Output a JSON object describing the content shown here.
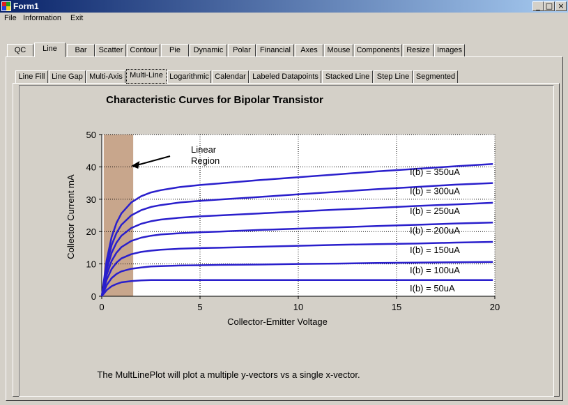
{
  "window": {
    "title": "Form1"
  },
  "menu": [
    "File",
    "Information",
    "Exit"
  ],
  "main_tabs": [
    "QC",
    "Line",
    "Bar",
    "Scatter",
    "Contour",
    "Pie",
    "Dynamic",
    "Polar",
    "Financial",
    "Axes",
    "Mouse",
    "Components",
    "Resize",
    "Images"
  ],
  "main_tab_active": "Line",
  "sub_tabs": [
    "Line Fill",
    "Line Gap",
    "Multi-Axis",
    "Multi-Line",
    "Logarithmic",
    "Calendar",
    "Labeled Datapoints",
    "Stacked Line",
    "Step Line",
    "Segmented"
  ],
  "sub_tab_active": "Multi-Line",
  "caption": "The MultLinePlot will plot a multiple y-vectors vs a single x-vector.",
  "colors": {
    "line": "#2a1fcc",
    "region_fill": "#c8a68c",
    "grid": "#000000"
  },
  "chart_data": {
    "type": "line",
    "title": "Characteristic Curves for Bipolar Transistor",
    "xlabel": "Collector-Emitter Voltage",
    "ylabel": "Collector Current mA",
    "xlim": [
      0,
      20
    ],
    "ylim": [
      0,
      50
    ],
    "x_ticks": [
      "0",
      "5",
      "10",
      "15",
      "20"
    ],
    "y_ticks": [
      "0",
      "10",
      "20",
      "30",
      "40",
      "50"
    ],
    "grid": true,
    "x": [
      0,
      0.25,
      0.5,
      0.75,
      1,
      1.5,
      2,
      2.5,
      3,
      4,
      5,
      6,
      8,
      10,
      12,
      14,
      16,
      18,
      19.9
    ],
    "series": [
      {
        "name": "I(b) = 50uA",
        "values": [
          0,
          1.9,
          3.1,
          3.8,
          4.3,
          4.7,
          4.9,
          5.0,
          5.0,
          5.0,
          5.0,
          5.0,
          5.0,
          5.0,
          5.0,
          5.0,
          5.0,
          5.0,
          5.0
        ]
      },
      {
        "name": "I(b) = 100uA",
        "values": [
          0,
          3.4,
          5.6,
          6.9,
          7.7,
          8.5,
          8.9,
          9.2,
          9.3,
          9.5,
          9.6,
          9.7,
          9.8,
          10.0,
          10.1,
          10.3,
          10.4,
          10.5,
          10.6
        ]
      },
      {
        "name": "I(b) = 150uA",
        "values": [
          0,
          5.1,
          8.4,
          10.4,
          11.7,
          13.0,
          13.7,
          14.1,
          14.4,
          14.7,
          14.9,
          15.0,
          15.3,
          15.6,
          15.9,
          16.1,
          16.3,
          16.6,
          16.8
        ]
      },
      {
        "name": "I(b) = 200uA",
        "values": [
          0,
          6.6,
          10.9,
          13.5,
          15.2,
          17.1,
          18.1,
          18.7,
          19.1,
          19.5,
          19.8,
          20.0,
          20.5,
          20.9,
          21.3,
          21.7,
          22.1,
          22.5,
          22.8
        ]
      },
      {
        "name": "I(b) = 250uA",
        "values": [
          0,
          8.1,
          13.4,
          16.6,
          18.7,
          21.1,
          22.4,
          23.2,
          23.7,
          24.3,
          24.7,
          25.0,
          25.6,
          26.2,
          26.8,
          27.3,
          27.9,
          28.4,
          28.9
        ]
      },
      {
        "name": "I(b) = 300uA",
        "values": [
          0,
          9.6,
          15.8,
          19.6,
          22.1,
          25.0,
          26.6,
          27.6,
          28.2,
          29.0,
          29.5,
          29.9,
          30.7,
          31.5,
          32.3,
          33.1,
          33.8,
          34.5,
          35.0
        ]
      },
      {
        "name": "I(b) = 350uA",
        "values": [
          0,
          11.1,
          18.3,
          22.7,
          25.6,
          29.0,
          30.9,
          32.1,
          32.8,
          33.8,
          34.4,
          34.9,
          35.9,
          36.8,
          37.7,
          38.6,
          39.4,
          40.2,
          40.9
        ]
      }
    ],
    "shaded_region": {
      "x_from": 0.1,
      "x_to": 1.6
    },
    "annotation": {
      "text": [
        "Linear",
        "Region"
      ],
      "arrow_to": [
        1.5,
        40.3
      ]
    }
  }
}
